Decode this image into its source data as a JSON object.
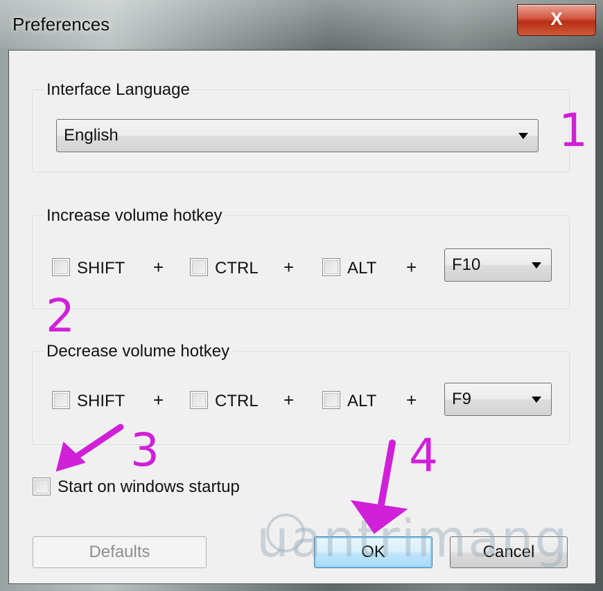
{
  "window": {
    "title": "Preferences",
    "close_label": "X"
  },
  "interface_language": {
    "group_label": "Interface Language",
    "selected": "English"
  },
  "increase_hotkey": {
    "group_label": "Increase volume hotkey",
    "shift_label": "SHIFT",
    "ctrl_label": "CTRL",
    "alt_label": "ALT",
    "plus": "+",
    "key": "F10"
  },
  "decrease_hotkey": {
    "group_label": "Decrease volume hotkey",
    "shift_label": "SHIFT",
    "ctrl_label": "CTRL",
    "alt_label": "ALT",
    "plus": "+",
    "key": "F9"
  },
  "startup": {
    "label": "Start on windows startup",
    "checked": false
  },
  "buttons": {
    "defaults": "Defaults",
    "ok": "OK",
    "cancel": "Cancel"
  },
  "annotations": {
    "one": "1",
    "two": "2",
    "three": "3",
    "four": "4",
    "color": "#d020d8"
  },
  "watermark": {
    "text": "uantrimang"
  }
}
